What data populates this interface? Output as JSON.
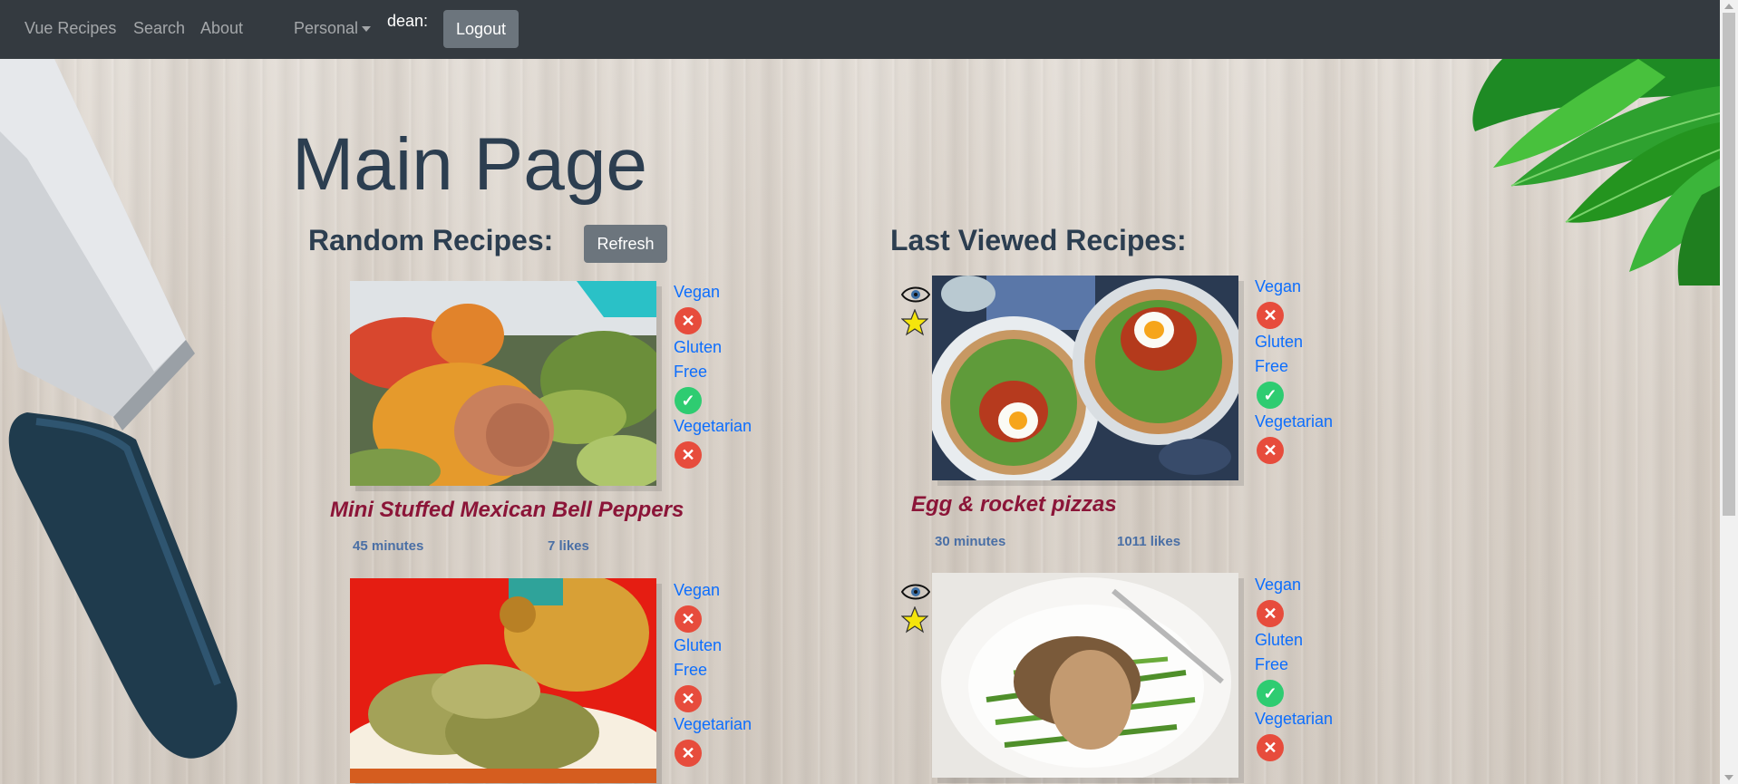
{
  "nav": {
    "brand": "Vue Recipes",
    "links": [
      "Search",
      "About"
    ],
    "dropdown": "Personal",
    "user": "dean:",
    "logout": "Logout"
  },
  "page": {
    "title": "Main Page"
  },
  "random": {
    "heading": "Random Recipes:",
    "refresh": "Refresh",
    "recipes": [
      {
        "title": "Mini Stuffed Mexican Bell Peppers",
        "time": "45 minutes",
        "likes": "7 likes",
        "vegan_label": "Vegan",
        "gluten_label_1": "Gluten",
        "gluten_label_2": "Free",
        "vegetarian_label": "Vegetarian",
        "vegan": false,
        "gluten_free": true,
        "vegetarian": false
      },
      {
        "title": "",
        "vegan_label": "Vegan",
        "gluten_label_1": "Gluten",
        "gluten_label_2": "Free",
        "vegetarian_label": "Vegetarian",
        "vegan": false,
        "gluten_free": false,
        "vegetarian": false
      }
    ]
  },
  "last_viewed": {
    "heading": "Last Viewed Recipes:",
    "recipes": [
      {
        "title": "Egg & rocket pizzas",
        "time": "30 minutes",
        "likes": "1011 likes",
        "vegan_label": "Vegan",
        "gluten_label_1": "Gluten",
        "gluten_label_2": "Free",
        "vegetarian_label": "Vegetarian",
        "vegan": false,
        "gluten_free": true,
        "vegetarian": false
      },
      {
        "title": "",
        "vegan_label": "Vegan",
        "gluten_label_1": "Gluten",
        "gluten_label_2": "Free",
        "vegetarian_label": "Vegetarian",
        "vegan": false,
        "gluten_free": true,
        "vegetarian": false
      }
    ]
  },
  "icons": {
    "yes": "check-icon",
    "no": "x-icon",
    "viewed": "eye-icon",
    "favorite": "star-icon"
  },
  "colors": {
    "navbar": "#343a40",
    "button": "#6c757d",
    "title": "#2c3e50",
    "recipe_title": "#8b1538",
    "link": "#0d6efd",
    "yes": "#2ecc71",
    "no": "#e74c3c"
  }
}
